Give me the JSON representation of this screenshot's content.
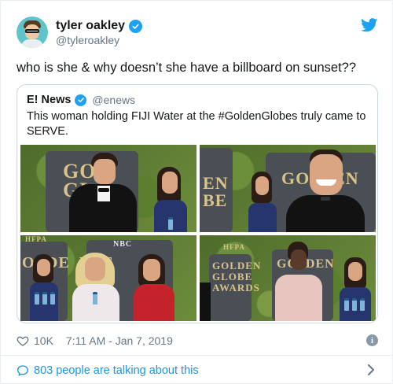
{
  "tweet": {
    "author": {
      "display_name": "tyler oakley",
      "handle": "@tyleroakley",
      "verified": true
    },
    "text": "who is she & why doesn’t she have a billboard on sunset??",
    "quoted": {
      "display_name": "E! News",
      "handle": "@enews",
      "verified": true,
      "text": "This woman holding FIJI Water at the #GoldenGlobes truly came to SERVE.",
      "photos": [
        {
          "sign_text": "GO\nGL"
        },
        {
          "sign_text_left": "EN\nBE",
          "sign_text_right": "GO  DEN"
        },
        {
          "label_top": "HFPA",
          "label_nbc": "NBC",
          "sign_text": "OLDE  LDE"
        },
        {
          "label_top": "HFPA",
          "sign_text": "GOLDEN\nGLOBE\nAWARDS",
          "sign_text_right": "GO  DEN"
        }
      ]
    },
    "likes": "10K",
    "timestamp": "7:11 AM - Jan 7, 2019",
    "talking_text": "803 people are talking about this"
  },
  "colors": {
    "accent": "#1da1f2",
    "link": "#1b95e0",
    "muted": "#657786"
  },
  "icons": [
    "twitter-bird-icon",
    "verified-badge-icon",
    "heart-icon",
    "info-icon",
    "comment-bubble-icon",
    "chevron-right-icon"
  ]
}
